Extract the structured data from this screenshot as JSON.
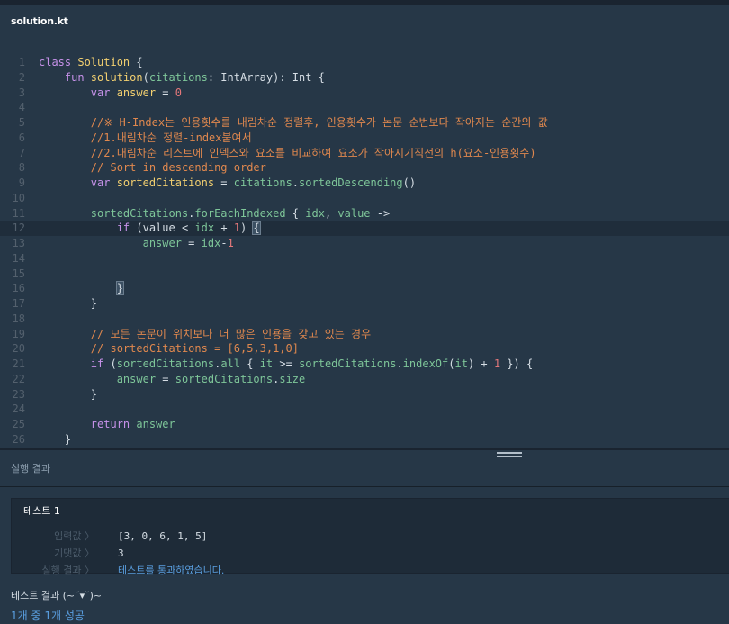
{
  "tab": {
    "filename": "solution.kt"
  },
  "editor": {
    "lines": [
      [
        {
          "t": "class ",
          "c": "t-kw"
        },
        {
          "t": "Solution",
          "c": "t-def"
        },
        {
          "t": " {",
          "c": "t-pun"
        }
      ],
      [
        {
          "t": "    fun ",
          "c": "t-kw"
        },
        {
          "t": "solution",
          "c": "t-def"
        },
        {
          "t": "(",
          "c": "t-pun"
        },
        {
          "t": "citations",
          "c": "t-param"
        },
        {
          "t": ": IntArray): Int {",
          "c": "t-ty"
        }
      ],
      [
        {
          "t": "        var ",
          "c": "t-kw"
        },
        {
          "t": "answer",
          "c": "t-def"
        },
        {
          "t": " = ",
          "c": "t-pun"
        },
        {
          "t": "0",
          "c": "t-num"
        }
      ],
      [],
      [
        {
          "t": "        //※ H-Index는 인용횟수를 내림차순 정렬후, 인용횟수가 논문 순번보다 작아지는 순간의 값",
          "c": "t-com"
        }
      ],
      [
        {
          "t": "        //1.내림차순 정렬-index붙여서",
          "c": "t-com"
        }
      ],
      [
        {
          "t": "        //2.내림차순 리스트에 인덱스와 요소를 비교하여 요소가 작아지기직전의 h(요소-인용횟수)",
          "c": "t-com"
        }
      ],
      [
        {
          "t": "        // Sort in descending order",
          "c": "t-com"
        }
      ],
      [
        {
          "t": "        var ",
          "c": "t-kw"
        },
        {
          "t": "sortedCitations",
          "c": "t-def"
        },
        {
          "t": " = ",
          "c": "t-pun"
        },
        {
          "t": "citations",
          "c": "t-fn"
        },
        {
          "t": ".",
          "c": "t-pun"
        },
        {
          "t": "sortedDescending",
          "c": "t-fn"
        },
        {
          "t": "()",
          "c": "t-pun"
        }
      ],
      [],
      [
        {
          "t": "        sortedCitations",
          "c": "t-fn"
        },
        {
          "t": ".",
          "c": "t-pun"
        },
        {
          "t": "forEachIndexed",
          "c": "t-fn"
        },
        {
          "t": " { ",
          "c": "t-pun"
        },
        {
          "t": "idx",
          "c": "t-fn"
        },
        {
          "t": ", ",
          "c": "t-pun"
        },
        {
          "t": "value",
          "c": "t-fn"
        },
        {
          "t": " ->",
          "c": "t-pun"
        }
      ],
      [
        {
          "t": "            if ",
          "c": "t-kw"
        },
        {
          "t": "(value < ",
          "c": "t-pun"
        },
        {
          "t": "idx",
          "c": "t-fn"
        },
        {
          "t": " + ",
          "c": "t-pun"
        },
        {
          "t": "1",
          "c": "t-num"
        },
        {
          "t": ") ",
          "c": "t-pun"
        },
        {
          "t": "{",
          "c": "t-pun bracket"
        }
      ],
      [
        {
          "t": "                answer",
          "c": "t-fn"
        },
        {
          "t": " = ",
          "c": "t-pun"
        },
        {
          "t": "idx",
          "c": "t-fn"
        },
        {
          "t": "-",
          "c": "t-pun"
        },
        {
          "t": "1",
          "c": "t-num"
        }
      ],
      [],
      [],
      [
        {
          "t": "            ",
          "c": "t-pun"
        },
        {
          "t": "}",
          "c": "t-pun bracket"
        }
      ],
      [
        {
          "t": "        }",
          "c": "t-pun"
        }
      ],
      [],
      [
        {
          "t": "        // 모든 논문이 위치보다 더 많은 인용을 갖고 있는 경우",
          "c": "t-com"
        }
      ],
      [
        {
          "t": "        // sortedCitations = [6,5,3,1,0]",
          "c": "t-com"
        }
      ],
      [
        {
          "t": "        if ",
          "c": "t-kw"
        },
        {
          "t": "(",
          "c": "t-pun"
        },
        {
          "t": "sortedCitations",
          "c": "t-fn"
        },
        {
          "t": ".",
          "c": "t-pun"
        },
        {
          "t": "all",
          "c": "t-fn"
        },
        {
          "t": " { ",
          "c": "t-pun"
        },
        {
          "t": "it",
          "c": "t-fn"
        },
        {
          "t": " >= ",
          "c": "t-pun"
        },
        {
          "t": "sortedCitations",
          "c": "t-fn"
        },
        {
          "t": ".",
          "c": "t-pun"
        },
        {
          "t": "indexOf",
          "c": "t-fn"
        },
        {
          "t": "(",
          "c": "t-pun"
        },
        {
          "t": "it",
          "c": "t-fn"
        },
        {
          "t": ") + ",
          "c": "t-pun"
        },
        {
          "t": "1",
          "c": "t-num"
        },
        {
          "t": " }) {",
          "c": "t-pun"
        }
      ],
      [
        {
          "t": "            answer",
          "c": "t-fn"
        },
        {
          "t": " = ",
          "c": "t-pun"
        },
        {
          "t": "sortedCitations",
          "c": "t-fn"
        },
        {
          "t": ".",
          "c": "t-pun"
        },
        {
          "t": "size",
          "c": "t-fn"
        }
      ],
      [
        {
          "t": "        }",
          "c": "t-pun"
        }
      ],
      [],
      [
        {
          "t": "        return ",
          "c": "t-kw"
        },
        {
          "t": "answer",
          "c": "t-fn"
        }
      ],
      [
        {
          "t": "    }",
          "c": "t-pun"
        }
      ]
    ],
    "active_line": 12
  },
  "results": {
    "header": "실행 결과",
    "test": {
      "title": "테스트 1",
      "input_label": "입력값 〉",
      "input_value": "[3, 0, 6, 1, 5]",
      "expected_label": "기댓값 〉",
      "expected_value": "3",
      "result_label": "실행 결과 〉",
      "result_value": "테스트를 통과하였습니다."
    },
    "summary_title": "테스트 결과 (~˘▾˘)~",
    "summary_value": "1개 중 1개 성공"
  }
}
